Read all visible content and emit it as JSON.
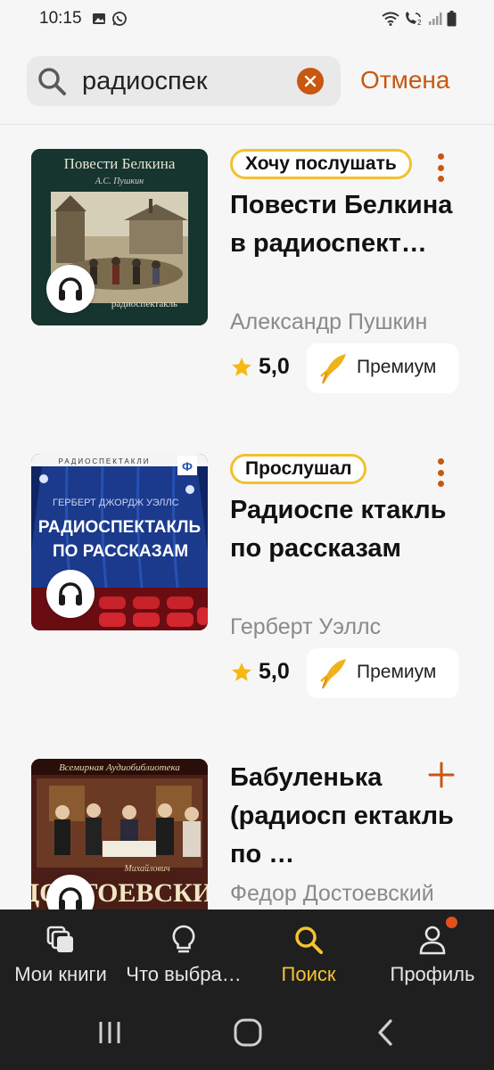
{
  "status_bar": {
    "time": "10:15",
    "left_icons": [
      "gallery-icon",
      "whatsapp-icon"
    ],
    "right_icons": [
      "wifi-icon",
      "wifi-call-icon",
      "signal-icon",
      "battery-icon"
    ]
  },
  "search": {
    "query": "радиоспек",
    "cancel_label": "Отмена"
  },
  "books": [
    {
      "status_label": "Хочу послушать",
      "title": "Повести Белкина в радиоспект…",
      "author": "Александр Пушкин",
      "rating": "5,0",
      "badge": "Премиум",
      "action": "more",
      "cover_title": "Повести Белкина",
      "cover_author": "А.С. Пушкин",
      "cover_subtitle": "радиоспектакль"
    },
    {
      "status_label": "Прослушал",
      "title": "Радиоспе ктакль по рассказам",
      "author": "Герберт Уэллс",
      "rating": "5,0",
      "badge": "Премиум",
      "action": "more",
      "cover_header": "РАДИОСПЕКТАКЛИ",
      "cover_author": "ГЕРБЕРТ ДЖОРДЖ УЭЛЛС",
      "cover_title_line1": "РАДИОСПЕКТАКЛЬ",
      "cover_title_line2": "ПО РАССКАЗАМ"
    },
    {
      "title": "Бабуленька (радиосп ектакль по …",
      "author": "Федор Достоевский",
      "action": "add",
      "cover_header": "Всемирная Аудиобиблиотека",
      "cover_author_small": "Михайлович",
      "cover_title": "ДОСТОЕВСКИЙ"
    }
  ],
  "bottom_nav": [
    {
      "label": "Мои книги",
      "icon": "my-books-icon",
      "active": false
    },
    {
      "label": "Что выбра…",
      "icon": "lightbulb-icon",
      "active": false
    },
    {
      "label": "Поиск",
      "icon": "search-icon",
      "active": true
    },
    {
      "label": "Профиль",
      "icon": "profile-icon",
      "active": false,
      "has_notification": true
    }
  ],
  "colors": {
    "accent": "#c9570f",
    "active_nav": "#f5c431",
    "pill_border": "#f2c12e",
    "nav_background": "#1f1f1f"
  }
}
